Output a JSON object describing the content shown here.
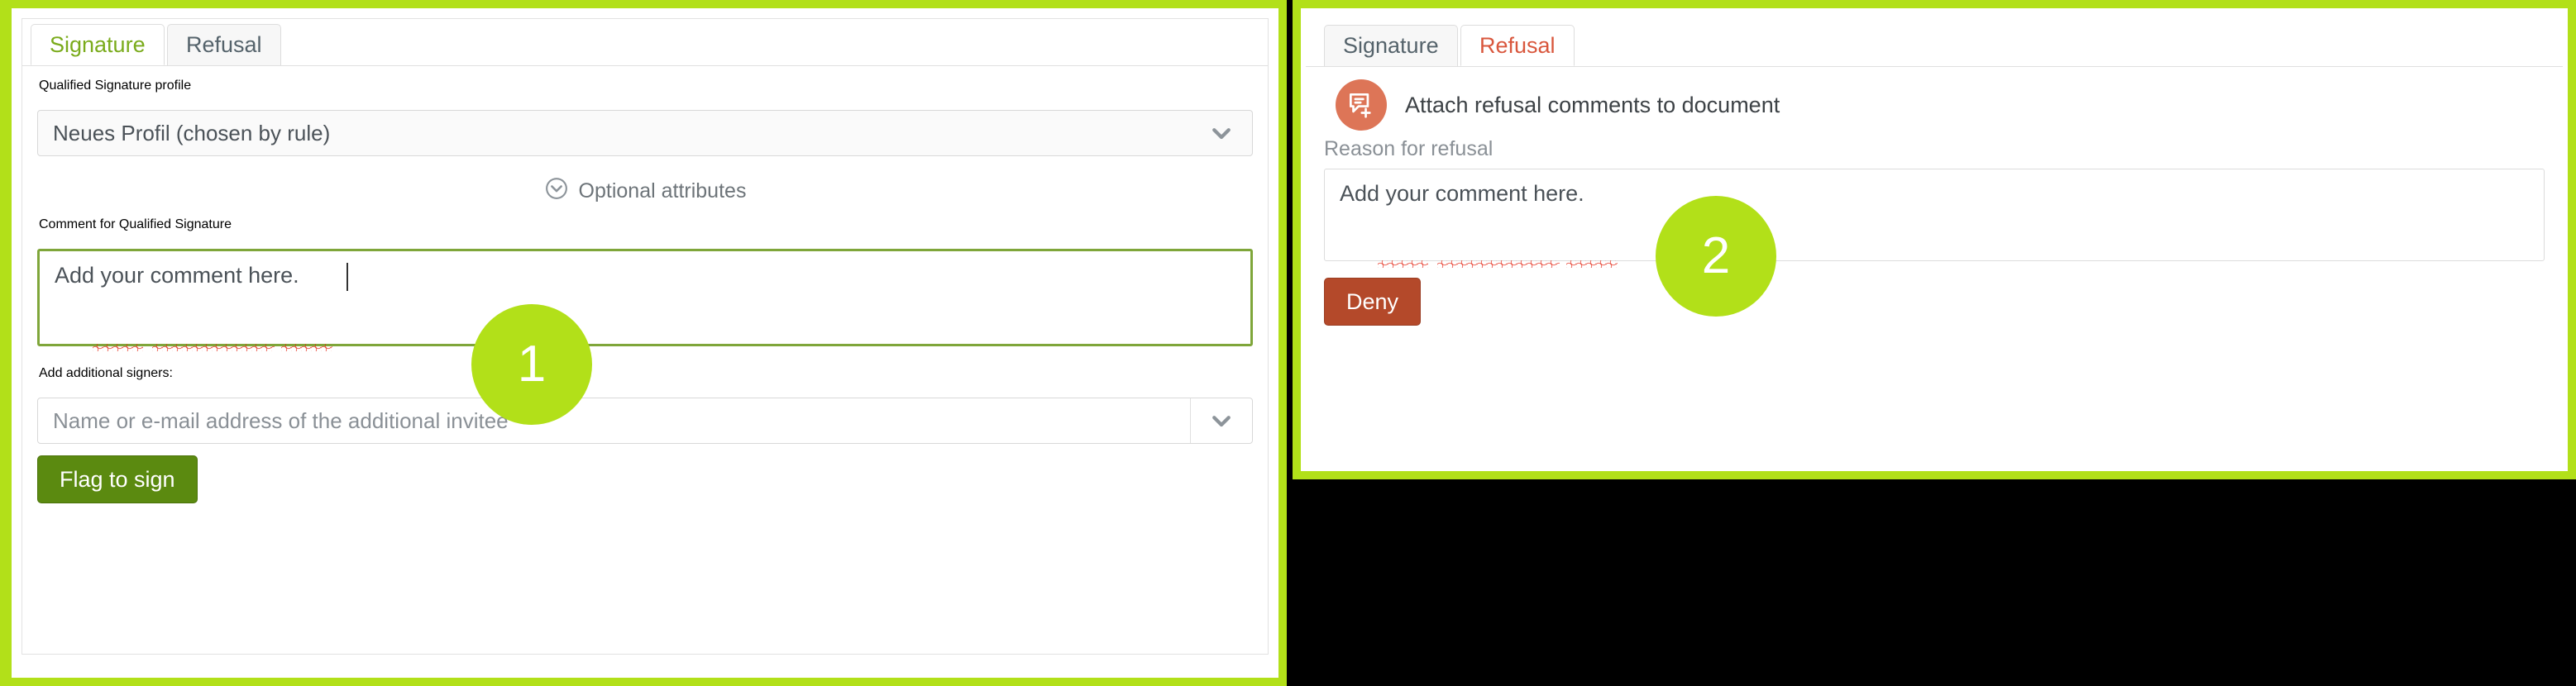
{
  "theme": {
    "accent_green": "#b2e019",
    "sign_button_green": "#5b8a10",
    "deny_button_red": "#b4492a",
    "refusal_tab_orange": "#d9573d",
    "signature_tab_green": "#7aab1b",
    "comment_icon_salmon": "#dd7557"
  },
  "left_panel": {
    "tabs": [
      {
        "label": "Signature",
        "active": true
      },
      {
        "label": "Refusal",
        "active": false
      }
    ],
    "profile_label": "Qualified Signature profile",
    "profile_value": "Neues Profil (chosen by rule)",
    "optional_attributes": "Optional attributes",
    "comment_label": "Comment for Qualified Signature",
    "comment_value": "Add your comment here.",
    "signers_label": "Add additional signers:",
    "signers_placeholder": "Name or e-mail address of the additional invitee",
    "submit_label": "Flag to sign"
  },
  "right_panel": {
    "tabs": [
      {
        "label": "Signature",
        "active": false
      },
      {
        "label": "Refusal",
        "active": true
      }
    ],
    "attach_label": "Attach refusal comments to document",
    "reason_label": "Reason for refusal",
    "reason_value": "Add your comment here.",
    "deny_label": "Deny"
  },
  "callouts": [
    {
      "number": "1"
    },
    {
      "number": "2"
    }
  ]
}
